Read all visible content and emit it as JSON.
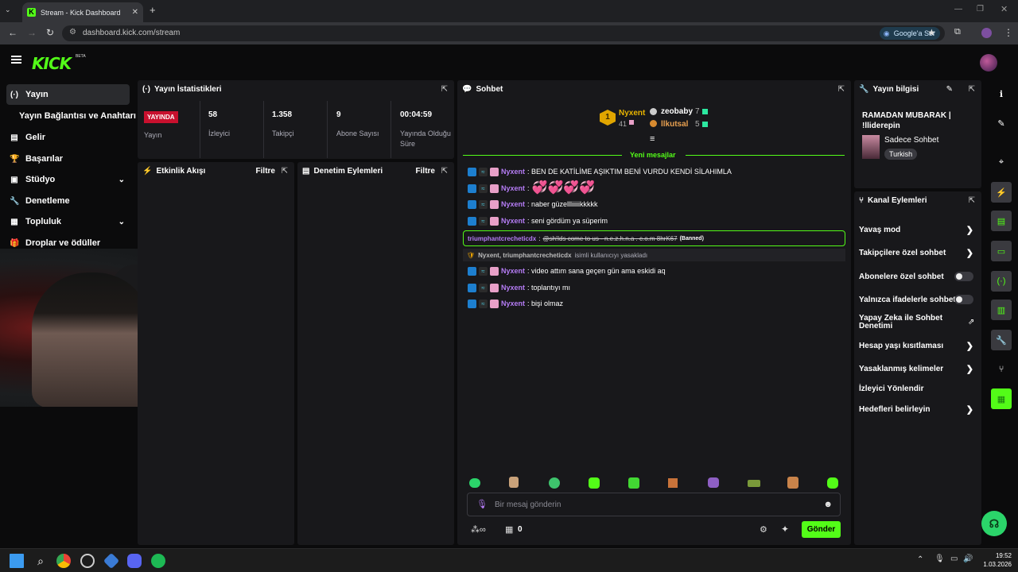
{
  "browser": {
    "tab_title": "Stream - Kick Dashboard",
    "url": "dashboard.kick.com/stream",
    "google_button": "Google'a Sor"
  },
  "logo": {
    "text": "KICK",
    "badge": "BETA"
  },
  "sidebar": {
    "items": [
      {
        "label": "Yayın",
        "icon": "broadcast-icon"
      },
      {
        "label": "Yayın Bağlantısı ve Anahtarı",
        "icon": ""
      },
      {
        "label": "Gelir",
        "icon": "chart-icon"
      },
      {
        "label": "Başarılar",
        "icon": "trophy-icon"
      },
      {
        "label": "Stüdyo",
        "icon": "studio-icon"
      },
      {
        "label": "Denetleme",
        "icon": "wrench-icon"
      },
      {
        "label": "Topluluk",
        "icon": "people-icon"
      },
      {
        "label": "Droplar ve ödüller",
        "icon": "gift-icon"
      }
    ]
  },
  "stats": {
    "title": "Yayın İstatistikleri",
    "live_badge": "YAYINDA",
    "live_label": "Yayın",
    "viewers": {
      "value": "58",
      "label": "İzleyici"
    },
    "followers": {
      "value": "1.358",
      "label": "Takipçi"
    },
    "subs": {
      "value": "9",
      "label": "Abone Sayısı"
    },
    "uptime": {
      "value": "00:04:59",
      "label": "Yayında Olduğu Süre"
    }
  },
  "activity": {
    "title": "Etkinlik Akışı",
    "filter": "Filtre"
  },
  "moderation": {
    "title": "Denetim Eylemleri",
    "filter": "Filtre"
  },
  "chat": {
    "title": "Sohbet",
    "leaderboard": {
      "first": {
        "rank": "1",
        "name": "Nyxent",
        "count": "41"
      },
      "second": {
        "name": "zeobaby",
        "count": "7"
      },
      "third": {
        "name": "llkutsal",
        "count": "5"
      }
    },
    "new_messages": "Yeni mesajlar",
    "messages": [
      {
        "user": "Nyxent",
        "text": ": BEN DE KATİLİME AŞIKTIM BENİ VURDU KENDİ SİLAHIMLA"
      },
      {
        "user": "Nyxent",
        "text": ":",
        "emotes": "💞💞💞💞"
      },
      {
        "user": "Nyxent",
        "text": ": naber güzellliiiiikkkkk"
      },
      {
        "user": "Nyxent",
        "text": ": seni gördüm ya süperim"
      }
    ],
    "banned_message": {
      "user": "triumphantcrecheticdx",
      "text": "@sh!lds come to us - n.e.z.h.n.a . c.o.m 8hrK67",
      "tag": "(Banned)"
    },
    "ban_notice": {
      "actor": "Nyxent, triumphantcrecheticdx",
      "text": "isimli kullanıcıyı yasakladı"
    },
    "messages2": [
      {
        "user": "Nyxent",
        "text": ": video attım sana geçen gün ama eskidi aq"
      },
      {
        "user": "Nyxent",
        "text": ": toplantıyı mı"
      },
      {
        "user": "Nyxent",
        "text": ": bişi olmaz"
      }
    ],
    "input_placeholder": "Bir mesaj gönderin",
    "points": "0",
    "send": "Gönder"
  },
  "stream_info": {
    "title": "Yayın bilgisi",
    "stream_title": "RAMADAN MUBARAK | !lliderepin",
    "category": "Sadece Sohbet",
    "tag": "Turkish"
  },
  "channel_actions": {
    "title": "Kanal Eylemleri",
    "items": [
      {
        "label": "Yavaş mod",
        "kind": "arrow"
      },
      {
        "label": "Takipçilere özel sohbet",
        "kind": "arrow"
      },
      {
        "label": "Abonelere özel sohbet",
        "kind": "toggle"
      },
      {
        "label": "Yalnızca ifadelerle sohbet",
        "kind": "toggle"
      },
      {
        "label": "Yapay Zeka ile Sohbet Denetimi",
        "kind": "external"
      },
      {
        "label": "Hesap yaşı kısıtlaması",
        "kind": "arrow"
      },
      {
        "label": "Yasaklanmış kelimeler",
        "kind": "arrow"
      },
      {
        "label": "İzleyici Yönlendir",
        "kind": "none"
      },
      {
        "label": "Hedefleri belirleyin",
        "kind": "arrow"
      }
    ]
  },
  "taskbar": {
    "time": "19:52",
    "date": "1.03.2026"
  },
  "colors": {
    "accent": "#53fc18",
    "live": "#c8102e",
    "username": "#b57cf5"
  }
}
